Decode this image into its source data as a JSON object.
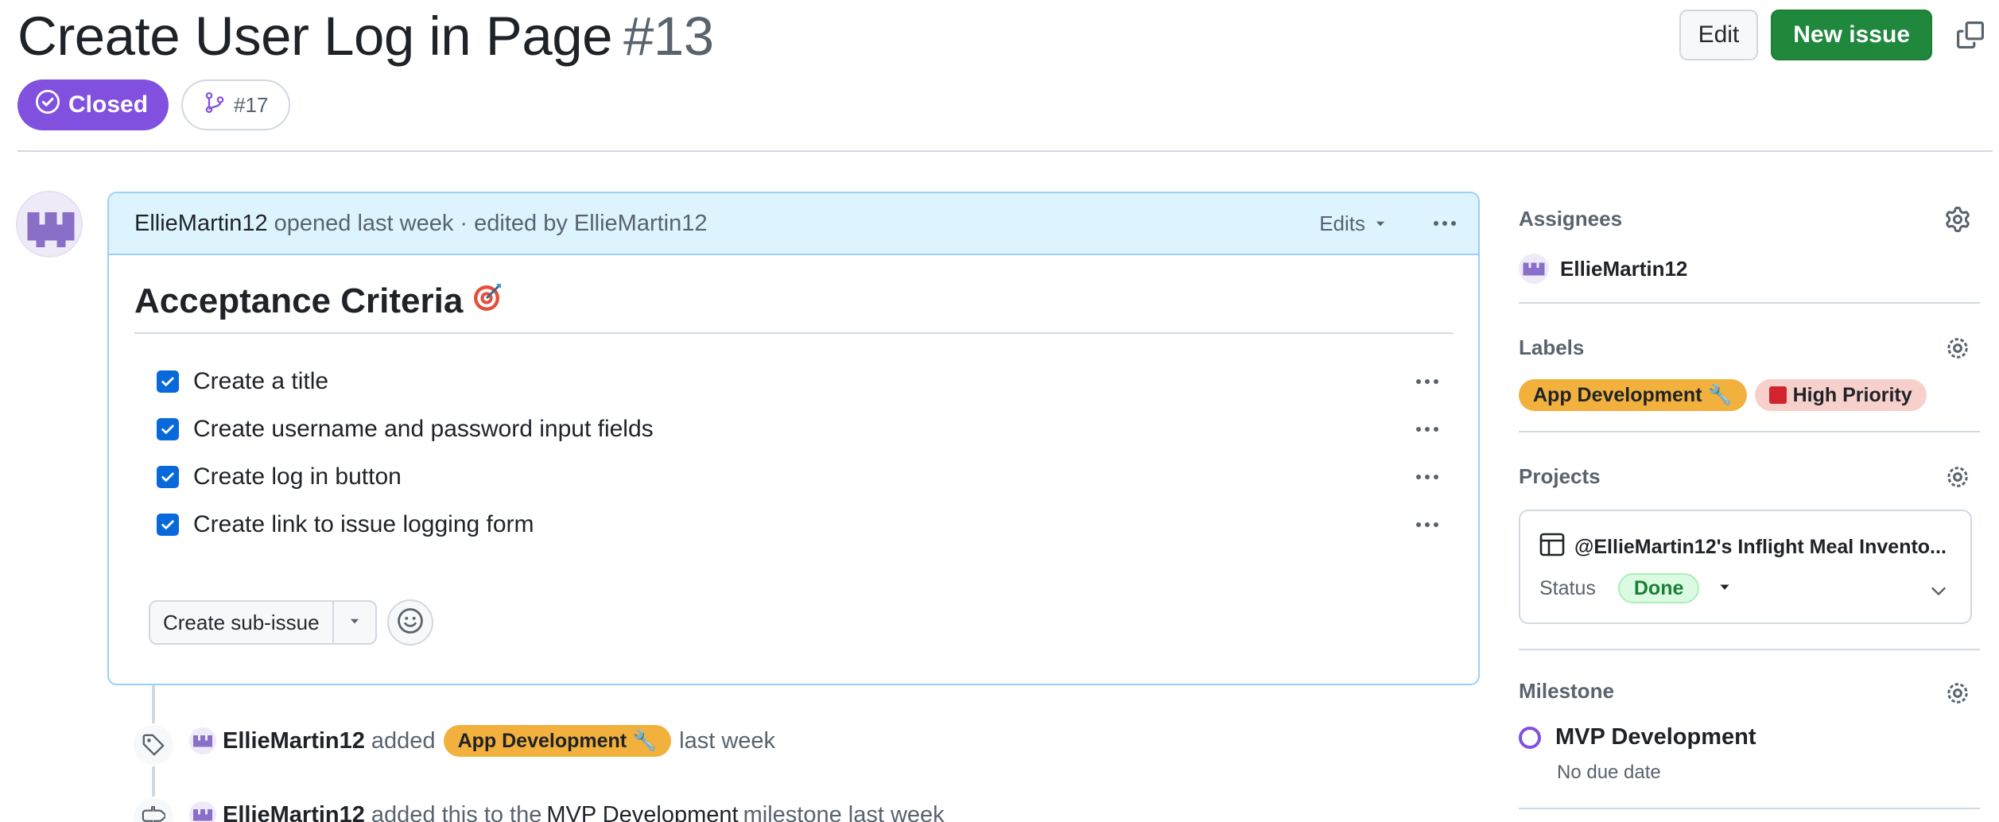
{
  "issue": {
    "title": "Create User Log in Page",
    "number": "#13",
    "state": "Closed",
    "linked_pr": "#17"
  },
  "header_actions": {
    "edit_label": "Edit",
    "new_issue_label": "New issue"
  },
  "comment": {
    "author": "EllieMartin12",
    "meta": "opened last week · edited by EllieMartin12",
    "edits_label": "Edits",
    "heading": "Acceptance Criteria",
    "heading_emoji": "🎯",
    "tasks": [
      {
        "label": "Create a title",
        "checked": true
      },
      {
        "label": "Create username and password input fields",
        "checked": true
      },
      {
        "label": "Create log in button",
        "checked": true
      },
      {
        "label": "Create link to issue logging form",
        "checked": true
      }
    ],
    "create_sub_issue_label": "Create sub-issue"
  },
  "timeline": [
    {
      "actor": "EllieMartin12",
      "action": "added",
      "label": "App Development 🔧",
      "time": "last week"
    },
    {
      "actor": "EllieMartin12",
      "action": "added this to the",
      "target": "MVP Development",
      "suffix": "milestone last week"
    }
  ],
  "sidebar": {
    "assignees": {
      "title": "Assignees",
      "names": [
        "EllieMartin12"
      ]
    },
    "labels": {
      "title": "Labels",
      "items": [
        {
          "name": "App Development 🔧",
          "color": "#f2b03d"
        },
        {
          "name": "High Priority",
          "color": "#f8d0cb",
          "prefix_color": "#d1242f"
        }
      ]
    },
    "projects": {
      "title": "Projects",
      "project_name": "@EllieMartin12's Inflight Meal Invento...",
      "status_label": "Status",
      "status_value": "Done"
    },
    "milestone": {
      "title": "Milestone",
      "name": "MVP Development",
      "due": "No due date"
    }
  },
  "colors": {
    "closed_purple": "#8250df",
    "primary_green": "#1f883d",
    "checkbox_blue": "#0969da",
    "comment_header_bg": "#ddf4ff"
  },
  "icons": [
    "check-circle-icon",
    "pull-request-icon",
    "copy-icon",
    "kebab-icon",
    "chevron-down-icon",
    "smiley-icon",
    "tag-icon",
    "milestone-icon",
    "gear-icon",
    "table-icon"
  ]
}
